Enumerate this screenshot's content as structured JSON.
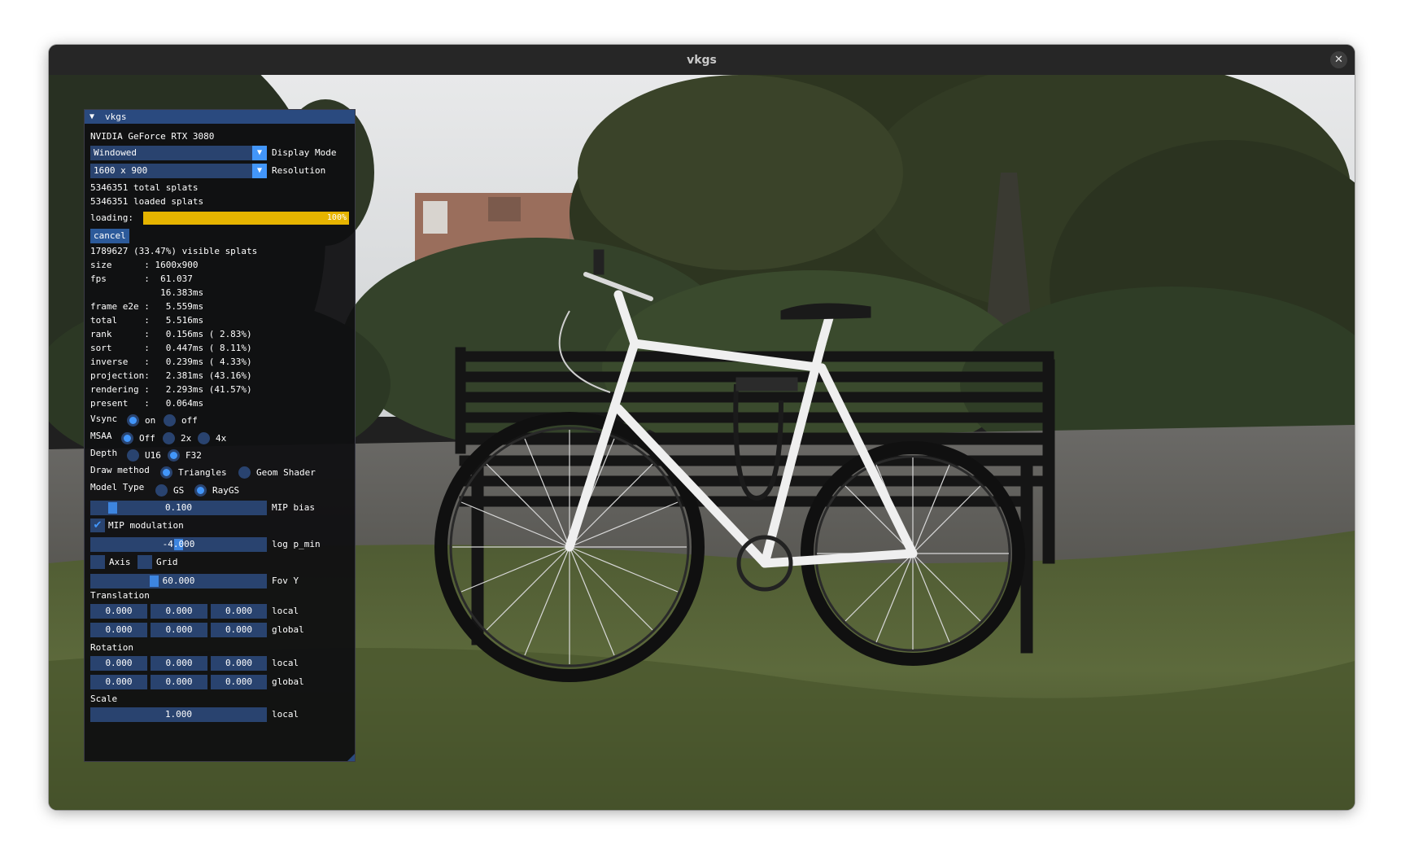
{
  "window": {
    "title": "vkgs"
  },
  "panel": {
    "title": "vkgs",
    "gpu": "NVIDIA GeForce RTX 3080",
    "display_mode": {
      "value": "Windowed",
      "label": "Display Mode"
    },
    "resolution": {
      "value": "1600 x 900",
      "label": "Resolution"
    },
    "total_splats": "5346351 total splats",
    "loaded_splats": "5346351 loaded splats",
    "loading": {
      "label": "loading:",
      "progress": 1.0,
      "text": "100%"
    },
    "cancel_label": "cancel",
    "visible_splats": "1789627 (33.47%) visible splats",
    "stats": [
      "size      : 1600x900",
      "fps       :  61.037",
      "             16.383ms",
      "frame e2e :   5.559ms",
      "total     :   5.516ms",
      "rank      :   0.156ms ( 2.83%)",
      "sort      :   0.447ms ( 8.11%)",
      "inverse   :   0.239ms ( 4.33%)",
      "projection:   2.381ms (43.16%)",
      "rendering :   2.293ms (41.57%)",
      "present   :   0.064ms"
    ],
    "vsync": {
      "label": "Vsync",
      "options": [
        "on",
        "off"
      ],
      "selected": "on"
    },
    "msaa": {
      "label": "MSAA",
      "options": [
        "Off",
        "2x",
        "4x"
      ],
      "selected": "Off"
    },
    "depth": {
      "label": "Depth",
      "options": [
        "U16",
        "F32"
      ],
      "selected": "F32"
    },
    "draw_method": {
      "label": "Draw method",
      "options": [
        "Triangles",
        "Geom Shader"
      ],
      "selected": "Triangles"
    },
    "model_type": {
      "label": "Model Type",
      "options": [
        "GS",
        "RayGS"
      ],
      "selected": "RayGS"
    },
    "mip_bias": {
      "value": "0.100",
      "label": "MIP bias",
      "fraction": 0.1
    },
    "mip_modulation": {
      "label": "MIP modulation",
      "checked": true
    },
    "log_p_min": {
      "value": "-4.000",
      "label": "log p_min",
      "fraction": 0.5
    },
    "axis": {
      "label": "Axis",
      "checked": false
    },
    "grid": {
      "label": "Grid",
      "checked": false
    },
    "fov_y": {
      "value": "60.000",
      "label": "Fov Y",
      "fraction": 0.35
    },
    "translation": {
      "label": "Translation",
      "local": {
        "values": [
          "0.000",
          "0.000",
          "0.000"
        ],
        "label": "local"
      },
      "global": {
        "values": [
          "0.000",
          "0.000",
          "0.000"
        ],
        "label": "global"
      }
    },
    "rotation": {
      "label": "Rotation",
      "local": {
        "values": [
          "0.000",
          "0.000",
          "0.000"
        ],
        "label": "local"
      },
      "global": {
        "values": [
          "0.000",
          "0.000",
          "0.000"
        ],
        "label": "global"
      }
    },
    "scale": {
      "label": "Scale",
      "value": "1.000",
      "local_label": "local"
    }
  }
}
